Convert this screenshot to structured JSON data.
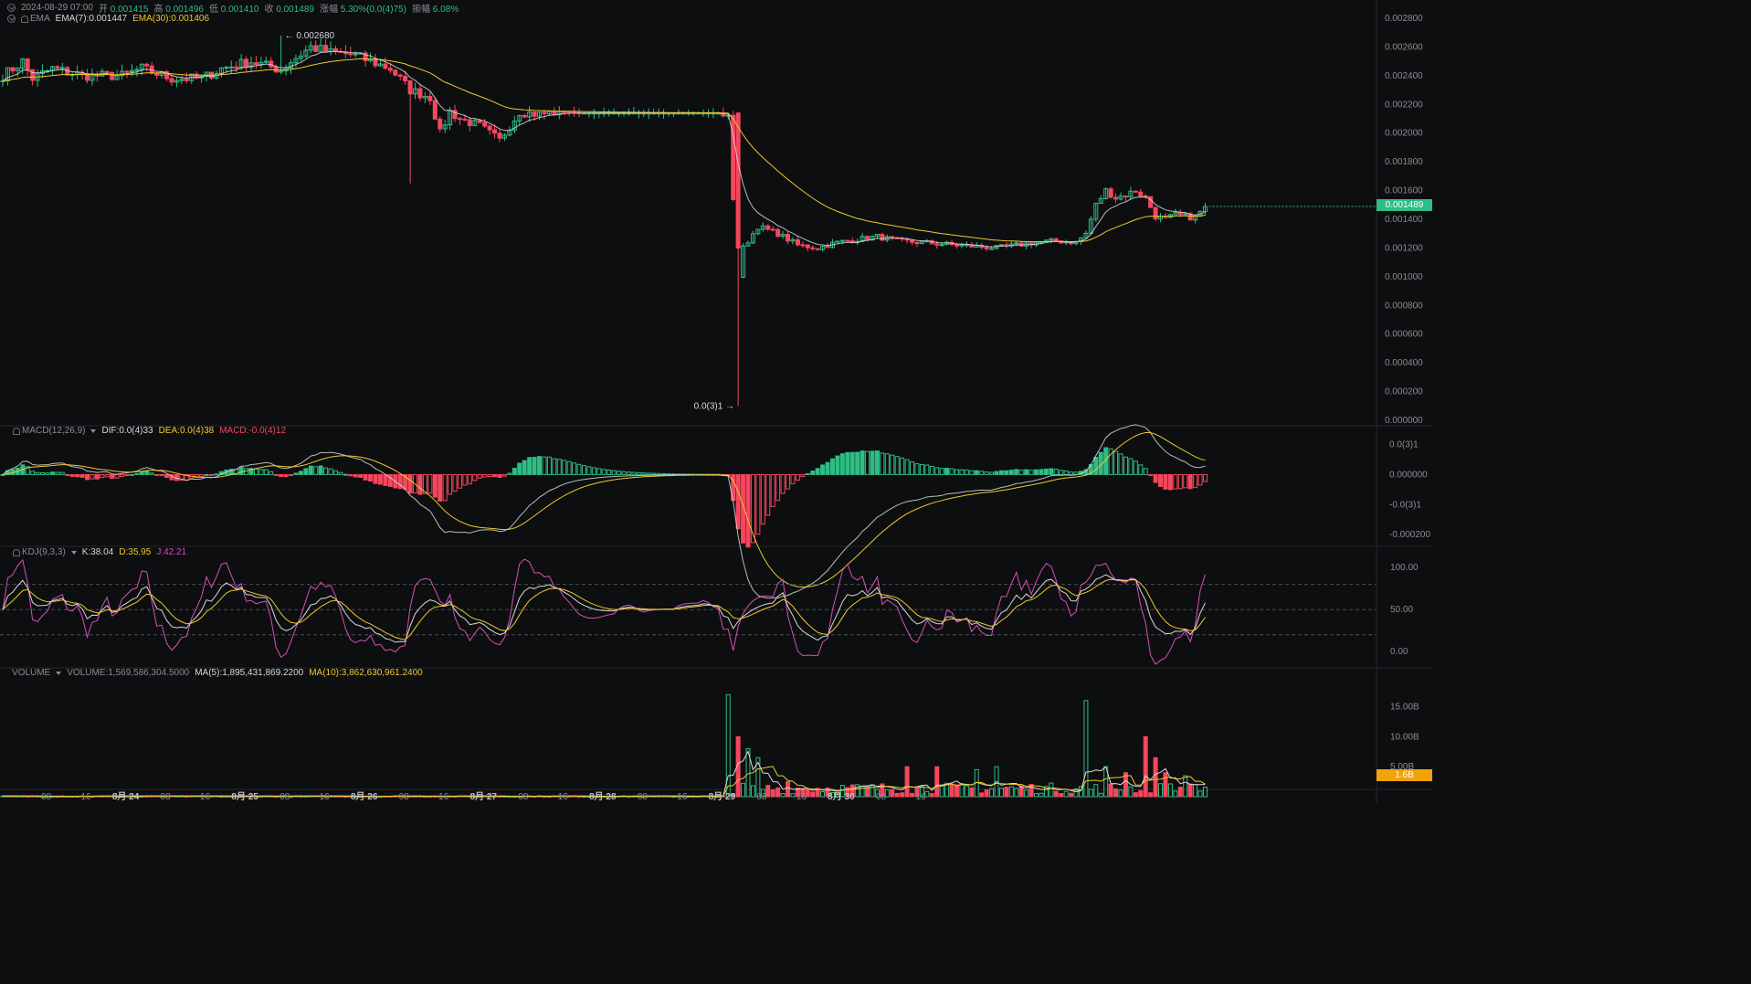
{
  "header": {
    "datetime": "2024-08-29 07:00",
    "open_label": "开",
    "open": "0.001415",
    "high_label": "高",
    "high": "0.001496",
    "low_label": "低",
    "low": "0.001410",
    "close_label": "收",
    "close": "0.001489",
    "change_label": "涨幅",
    "change": "5.30%(0.0(4)75)",
    "amplitude_label": "振幅",
    "amplitude": "6.08%"
  },
  "ema_legend": {
    "name": "EMA",
    "ema7": "EMA(7):0.001447",
    "ema30": "EMA(30):0.001406"
  },
  "macd_legend": {
    "name": "MACD(12,26,9)",
    "dif": "DIF:0.0(4)33",
    "dea": "DEA:0.0(4)38",
    "macd": "MACD:-0.0(4)12"
  },
  "kdj_legend": {
    "name": "KDJ(9,3,3)",
    "k": "K:38.04",
    "d": "D:35.95",
    "j": "J:42.21"
  },
  "volume_legend": {
    "name": "VOLUME",
    "volume": "VOLUME:1,569,586,304.5000",
    "ma5": "MA(5):1,895,431,869.2200",
    "ma10": "MA(10):3,862,630,961.2400"
  },
  "annotations": {
    "max_label": "← 0.002680",
    "min_label": "0.0(3)1 →"
  },
  "current_price_tag": "0.001489",
  "current_volume_tag": "1.6B",
  "colors": {
    "up": "#2ebd85",
    "down": "#f6465d",
    "ema7": "#d8d9dc",
    "ema30": "#f0c92b",
    "j_line": "#d94fb6",
    "background": "#0d0e10",
    "price_tag": "#2ebd85",
    "volume_tag": "#f0a30a"
  },
  "chart_data": [
    {
      "type": "candlestick",
      "panel": "price",
      "interval": "1h",
      "y_ticks": [
        "0.002800",
        "0.002600",
        "0.002400",
        "0.002200",
        "0.002000",
        "0.001800",
        "0.001600",
        "0.001400",
        "0.001200",
        "0.001000",
        "0.000800",
        "0.000600",
        "0.000400",
        "0.000200",
        "0.000000"
      ],
      "ylim": [
        0,
        0.0028
      ],
      "x_ticks": [
        "08",
        "16",
        "8月 24",
        "08",
        "16",
        "8月 25",
        "08",
        "16",
        "8月 26",
        "08",
        "16",
        "8月 27",
        "08",
        "16",
        "8月 28",
        "08",
        "16",
        "8月 29",
        "08",
        "16",
        "8月 30",
        "08",
        "16"
      ],
      "x_start": "2024-08-23 00:00",
      "close_anchors": [
        [
          0,
          0.0024
        ],
        [
          4,
          0.0025
        ],
        [
          6,
          0.00238
        ],
        [
          10,
          0.00245
        ],
        [
          16,
          0.0024
        ],
        [
          24,
          0.0024
        ],
        [
          28,
          0.00245
        ],
        [
          34,
          0.00238
        ],
        [
          40,
          0.00238
        ],
        [
          44,
          0.00245
        ],
        [
          50,
          0.0025
        ],
        [
          56,
          0.00244
        ],
        [
          58,
          0.0025
        ],
        [
          62,
          0.0026
        ],
        [
          66,
          0.00256
        ],
        [
          70,
          0.00255
        ],
        [
          74,
          0.0025
        ],
        [
          78,
          0.00245
        ],
        [
          82,
          0.0023
        ],
        [
          86,
          0.00225
        ],
        [
          88,
          0.002
        ],
        [
          90,
          0.00215
        ],
        [
          92,
          0.0021
        ],
        [
          96,
          0.00205
        ],
        [
          100,
          0.00195
        ],
        [
          102,
          0.00205
        ],
        [
          104,
          0.00215
        ],
        [
          108,
          0.00213
        ],
        [
          112,
          0.00215
        ],
        [
          116,
          0.00214
        ],
        [
          120,
          0.00214
        ],
        [
          126,
          0.00214
        ],
        [
          132,
          0.00214
        ],
        [
          138,
          0.00214
        ],
        [
          144,
          0.00214
        ],
        [
          146,
          0.0021
        ],
        [
          148,
          0.001
        ],
        [
          149,
          0.0012
        ],
        [
          150,
          0.00125
        ],
        [
          152,
          0.00135
        ],
        [
          156,
          0.0013
        ],
        [
          160,
          0.00122
        ],
        [
          164,
          0.0012
        ],
        [
          168,
          0.00124
        ],
        [
          172,
          0.00126
        ],
        [
          176,
          0.00128
        ],
        [
          180,
          0.00125
        ],
        [
          184,
          0.00124
        ],
        [
          188,
          0.00123
        ],
        [
          192,
          0.00122
        ],
        [
          196,
          0.00121
        ],
        [
          200,
          0.0012
        ],
        [
          204,
          0.00122
        ],
        [
          208,
          0.00124
        ],
        [
          212,
          0.00125
        ],
        [
          216,
          0.00124
        ],
        [
          218,
          0.0013
        ],
        [
          220,
          0.0015
        ],
        [
          222,
          0.0016
        ],
        [
          224,
          0.00155
        ],
        [
          226,
          0.00157
        ],
        [
          228,
          0.0016
        ],
        [
          230,
          0.00155
        ],
        [
          232,
          0.00142
        ],
        [
          234,
          0.0014
        ],
        [
          236,
          0.00143
        ],
        [
          238,
          0.00142
        ],
        [
          240,
          0.00141
        ],
        [
          242,
          0.00149
        ]
      ],
      "max_price": 0.00268,
      "min_price": 0.0001,
      "last_close": 0.001489
    },
    {
      "type": "bar",
      "panel": "macd",
      "y_ticks": [
        "0.0(3)1",
        "0.000000",
        "-0.0(3)1",
        "-0.000200"
      ],
      "ylim": [
        -0.00023,
        0.00012
      ]
    },
    {
      "type": "line",
      "panel": "kdj",
      "y_ticks": [
        "100.00",
        "50.00",
        "0.00"
      ],
      "ylim": [
        -15,
        110
      ],
      "reference_lines": [
        20,
        50,
        80
      ]
    },
    {
      "type": "bar",
      "panel": "volume",
      "y_ticks": [
        "15.00B",
        "10.00B",
        "5.00B"
      ],
      "ylim": [
        0,
        17.5
      ],
      "spikes_billion": [
        [
          146,
          17
        ],
        [
          148,
          10
        ],
        [
          150,
          8
        ],
        [
          152,
          6.5
        ],
        [
          158,
          2.5
        ],
        [
          172,
          2
        ],
        [
          182,
          5
        ],
        [
          188,
          5
        ],
        [
          196,
          4.5
        ],
        [
          200,
          5
        ],
        [
          218,
          16
        ],
        [
          222,
          5
        ],
        [
          226,
          4
        ],
        [
          230,
          10
        ],
        [
          232,
          6.5
        ],
        [
          234,
          4
        ],
        [
          238,
          3.5
        ],
        [
          240,
          2
        ],
        [
          242,
          1.6
        ]
      ]
    }
  ]
}
